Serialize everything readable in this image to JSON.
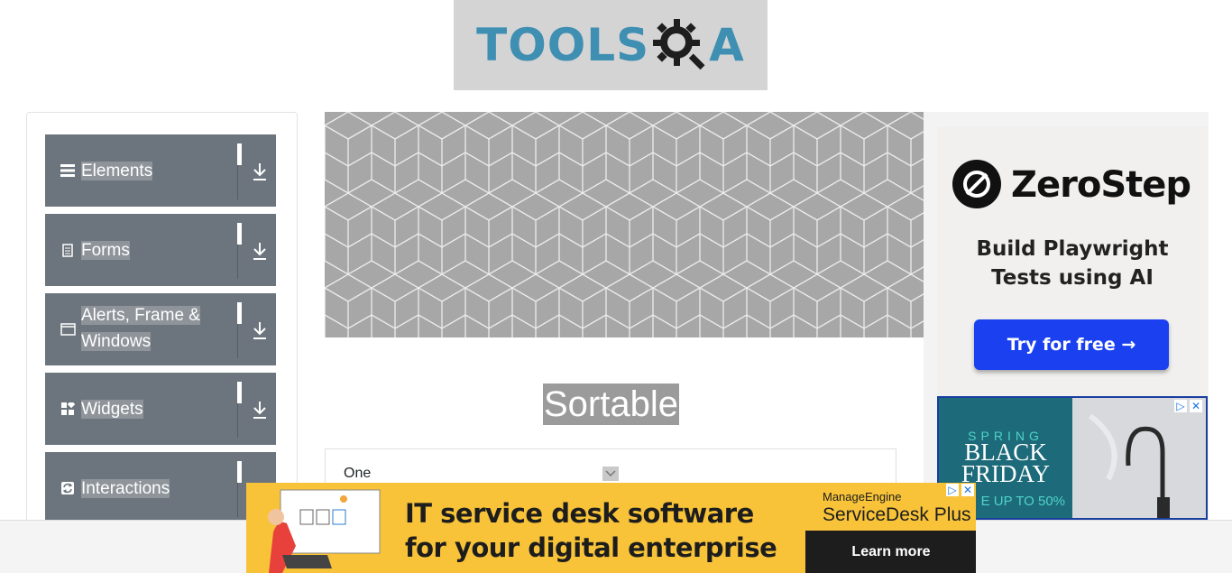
{
  "header": {
    "logo_text": "TOOLS",
    "logo_suffix": "A"
  },
  "sidebar": {
    "groups": [
      {
        "label": "Elements",
        "icon": "hamburger-icon"
      },
      {
        "label": "Forms",
        "icon": "document-icon"
      },
      {
        "label": "Alerts, Frame & Windows",
        "icon": "window-icon"
      },
      {
        "label": "Widgets",
        "icon": "widgets-icon"
      },
      {
        "label": "Interactions",
        "icon": "refresh-icon"
      }
    ]
  },
  "main": {
    "title": "Sortable",
    "list": [
      {
        "label": "One"
      }
    ]
  },
  "ads": {
    "zerostep": {
      "brand": "ZeroStep",
      "headline_line1": "Build Playwright",
      "headline_line2": "Tests using AI",
      "cta": "Try for free →"
    },
    "blackfriday": {
      "line1": "SPRING",
      "line2": "BLACK",
      "line3": "FRIDAY",
      "offer": "E UP TO 50%"
    },
    "servicedesk": {
      "headline_line1": "IT service desk software",
      "headline_line2": "for your digital enterprise",
      "brand_top": "ManageEngine",
      "brand_bottom": "ServiceDesk Plus",
      "cta": "Learn more"
    }
  },
  "colors": {
    "sidebar_group_bg": "#6c757d",
    "logo": "#3f8fb2",
    "zerostep_cta": "#1a40f0",
    "servicedesk_bg": "#f8c339"
  }
}
